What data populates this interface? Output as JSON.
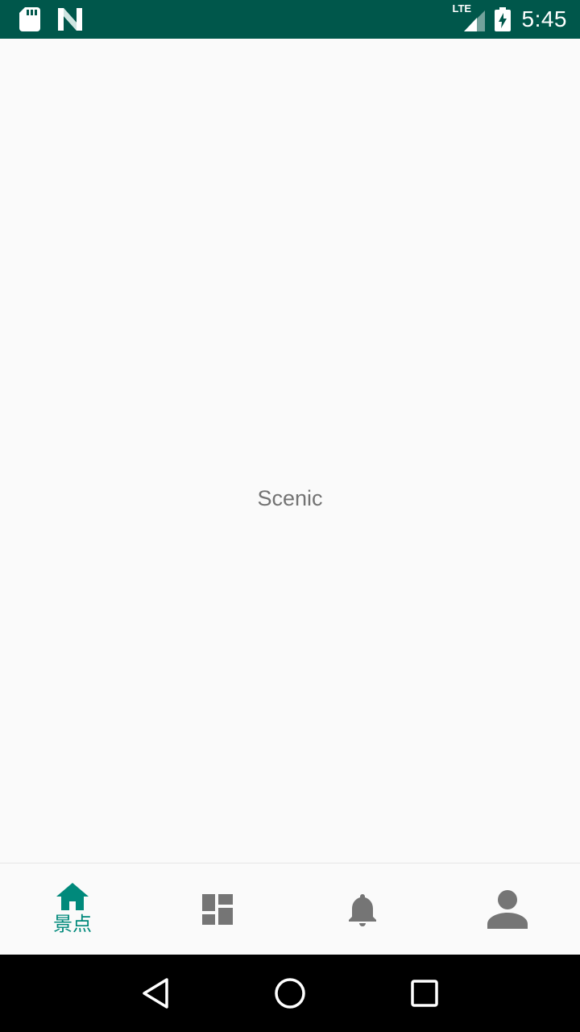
{
  "status_bar": {
    "time": "5:45",
    "network_label": "LTE",
    "left_icons": [
      "sd-card-icon",
      "n-logo-icon"
    ],
    "right_icons": [
      "lte-signal-icon",
      "battery-charging-icon"
    ],
    "background_color": "#00574b"
  },
  "main": {
    "text": "Scenic"
  },
  "bottom_nav": {
    "active_color": "#00897b",
    "inactive_color": "#757575",
    "items": [
      {
        "icon": "home-icon",
        "label": "景点",
        "active": true
      },
      {
        "icon": "dashboard-icon",
        "label": "",
        "active": false
      },
      {
        "icon": "bell-icon",
        "label": "",
        "active": false
      },
      {
        "icon": "person-icon",
        "label": "",
        "active": false
      }
    ]
  },
  "system_nav": {
    "buttons": [
      "back-icon",
      "home-circle-icon",
      "recents-icon"
    ]
  }
}
